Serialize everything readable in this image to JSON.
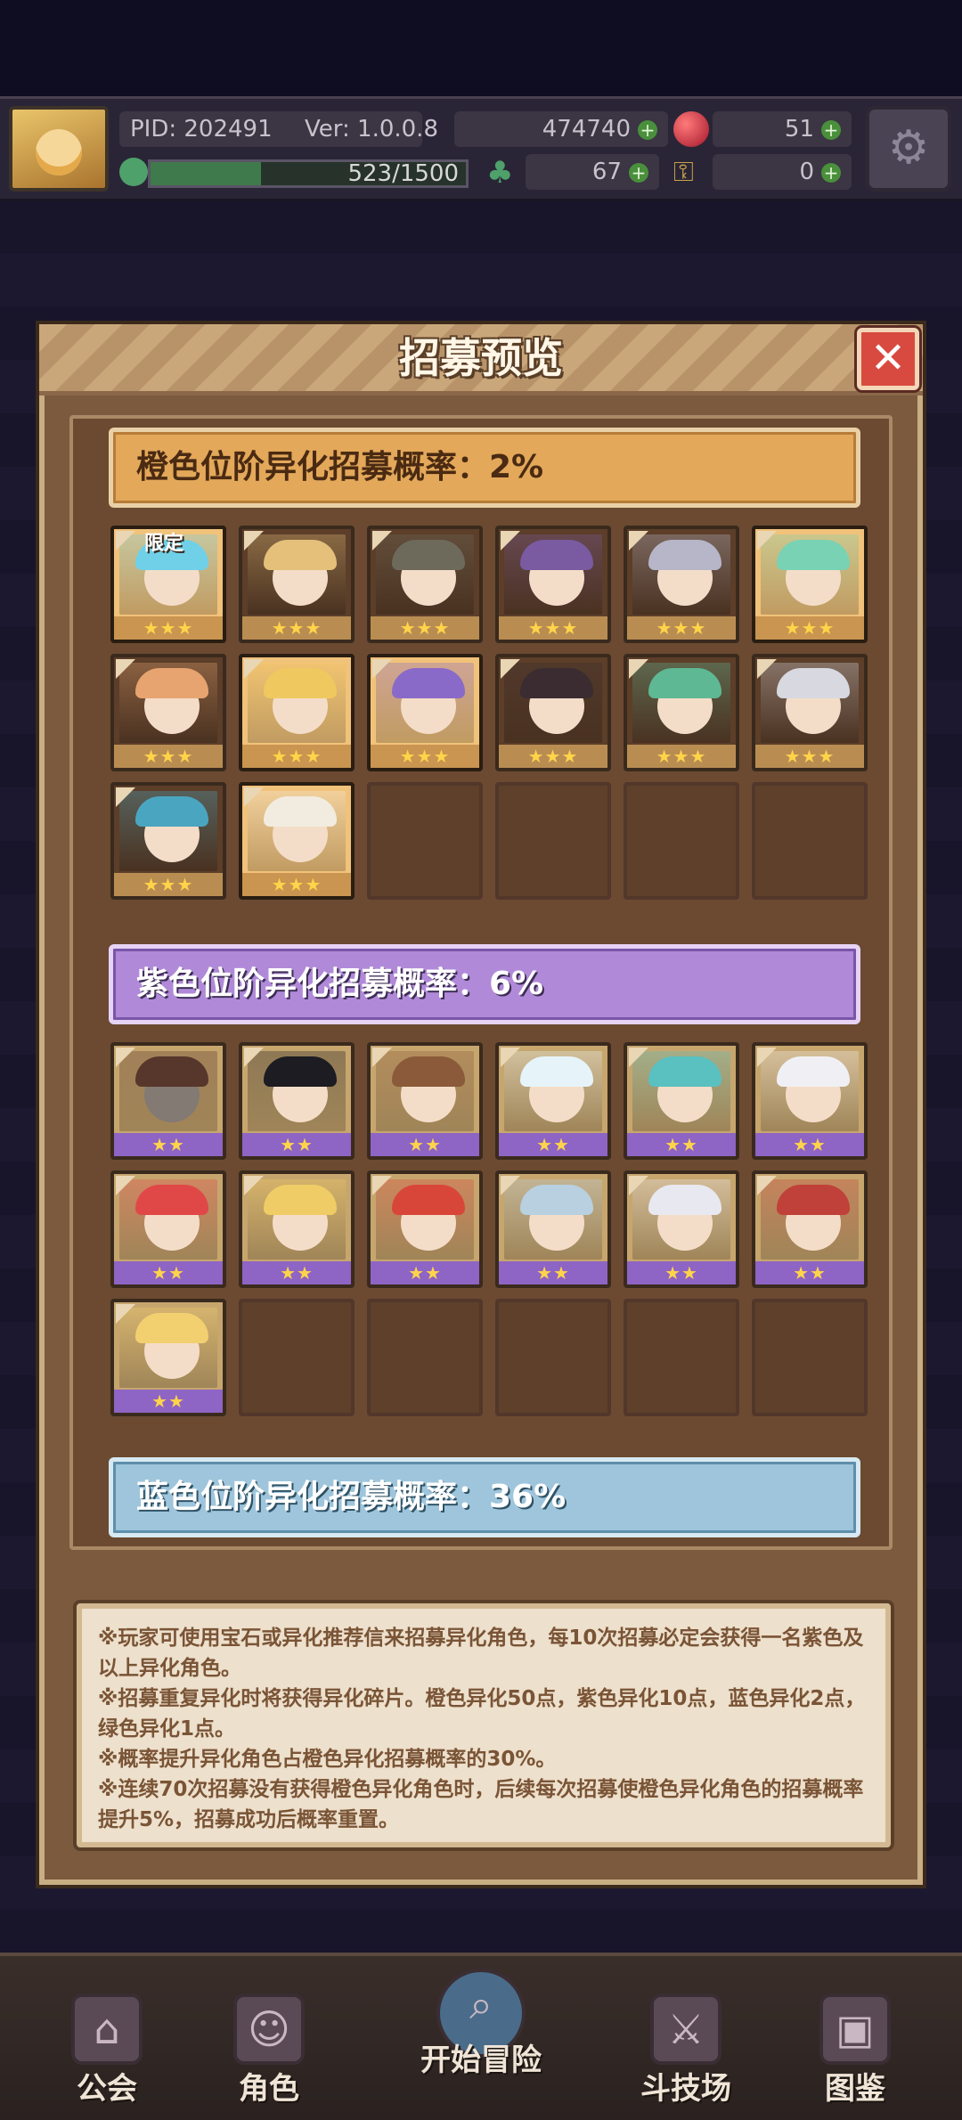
{
  "topbar": {
    "pid": "PID: 202491",
    "version": "Ver: 1.0.0.8",
    "gold": "474740",
    "rubies": "51",
    "energy": "523/1500",
    "energy_fraction": 0.349,
    "clovers": "67",
    "keys": "0"
  },
  "dialog": {
    "title": "招募预览",
    "tiers": {
      "orange": "橙色位阶异化招募概率：2%",
      "purple": "紫色位阶异化招募概率：6%",
      "blue": "蓝色位阶异化招募概率：36%"
    },
    "limited_label": "限定",
    "orange_chars": [
      {
        "stars": "★★★",
        "hair": "#6fd0e8",
        "highlight": true,
        "limited": true
      },
      {
        "stars": "★★★",
        "hair": "#e4c07a",
        "highlight": false
      },
      {
        "stars": "★★★",
        "hair": "#6d6a5c",
        "highlight": false
      },
      {
        "stars": "★★★",
        "hair": "#7a5aa0",
        "highlight": false
      },
      {
        "stars": "★★★",
        "hair": "#b6b6c8",
        "highlight": false
      },
      {
        "stars": "★★★",
        "hair": "#7ad2b4",
        "highlight": true
      },
      {
        "stars": "★★★",
        "hair": "#e7a470",
        "highlight": false
      },
      {
        "stars": "★★★",
        "hair": "#f0c860",
        "highlight": true
      },
      {
        "stars": "★★★",
        "hair": "#8a6ac8",
        "highlight": true
      },
      {
        "stars": "★★★",
        "hair": "#3a2c30",
        "highlight": false
      },
      {
        "stars": "★★★",
        "hair": "#5fb894",
        "highlight": false
      },
      {
        "stars": "★★★",
        "hair": "#d8d8e0",
        "highlight": false
      },
      {
        "stars": "★★★",
        "hair": "#4aa6c0",
        "highlight": false
      },
      {
        "stars": "★★★",
        "hair": "#f2ece0",
        "highlight": true
      }
    ],
    "purple_chars": [
      {
        "stars": "★★",
        "hair": "#c05a3c",
        "dim": true
      },
      {
        "stars": "★★",
        "hair": "#1c1c22"
      },
      {
        "stars": "★★",
        "hair": "#8a5a3a"
      },
      {
        "stars": "★★",
        "hair": "#e6f4fa"
      },
      {
        "stars": "★★",
        "hair": "#5ac0c0"
      },
      {
        "stars": "★★",
        "hair": "#f0f0f4"
      },
      {
        "stars": "★★",
        "hair": "#e04848"
      },
      {
        "stars": "★★",
        "hair": "#f0cc66"
      },
      {
        "stars": "★★",
        "hair": "#d8463a"
      },
      {
        "stars": "★★",
        "hair": "#b8d0e0"
      },
      {
        "stars": "★★",
        "hair": "#e8e8f0"
      },
      {
        "stars": "★★",
        "hair": "#c0403a"
      },
      {
        "stars": "★★",
        "hair": "#f2d070"
      }
    ],
    "notes": [
      "※玩家可使用宝石或异化推荐信来招募异化角色，每10次招募必定会获得一名紫色及以上异化角色。",
      "※招募重复异化时将获得异化碎片。橙色异化50点，紫色异化10点，蓝色异化2点，绿色异化1点。",
      "※概率提升异化角色占橙色异化招募概率的30%。",
      "※连续70次招募没有获得橙色异化角色时，后续每次招募使橙色异化角色的招募概率提升5%，招募成功后概率重置。"
    ]
  },
  "nav": {
    "guild": "公会",
    "characters": "角色",
    "adventure": "开始冒险",
    "arena": "斗技场",
    "codex": "图鉴"
  },
  "colors": {
    "orange_tier": "#e3a85a",
    "purple_tier": "#b08ad8",
    "blue_tier": "#9ec5db",
    "panel_brown": "#7b5a3e",
    "close_red": "#d84a3f"
  }
}
